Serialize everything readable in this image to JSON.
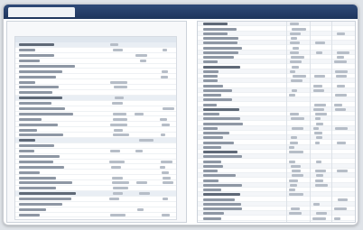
{
  "window": {
    "tab_label": "",
    "right_label": ""
  },
  "left_panel": {
    "header": ""
  },
  "colors": {
    "titlebar": "#24406a",
    "bars": "#8e97a4"
  }
}
